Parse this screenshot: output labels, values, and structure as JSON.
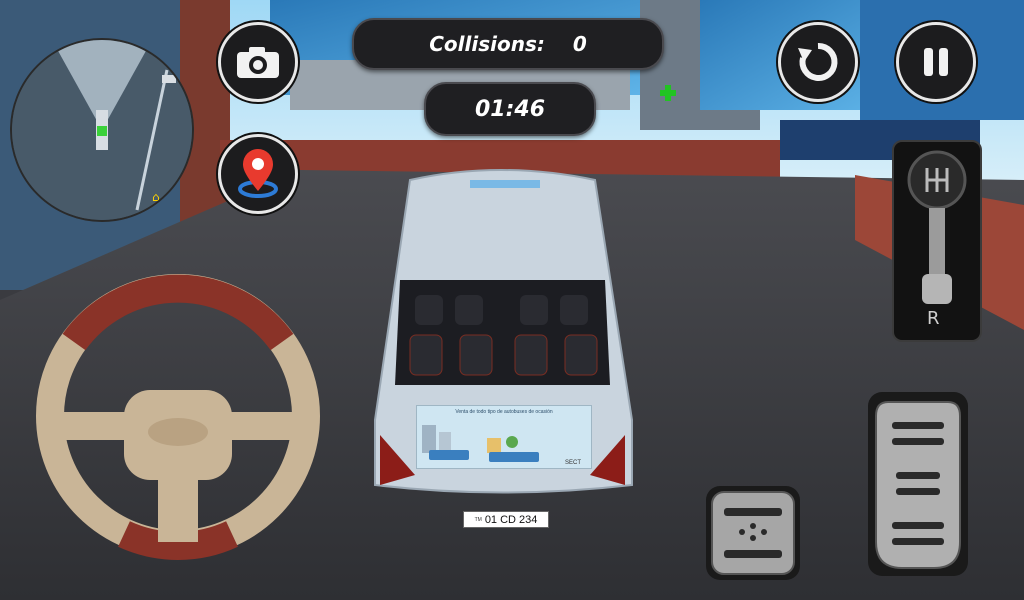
{
  "hud": {
    "collisions_label": "Collisions:",
    "collisions_value": "0",
    "timer": "01:46"
  },
  "bus": {
    "plate": "01 CD 234",
    "plate_prefix": "TM",
    "ad_text": "Venta de todo tipo de autobuses de ocasión",
    "ad_brand": "SECT"
  },
  "gear_shift": {
    "gear": "R"
  },
  "icons": {
    "camera": "camera-icon",
    "location": "location-pin-icon",
    "restart": "restart-icon",
    "pause": "pause-icon",
    "home_marker": "home-icon"
  },
  "colors": {
    "hud_bg": "#1f1f22",
    "pin_red": "#e83a2e",
    "minimap_green": "#3ad13a"
  }
}
